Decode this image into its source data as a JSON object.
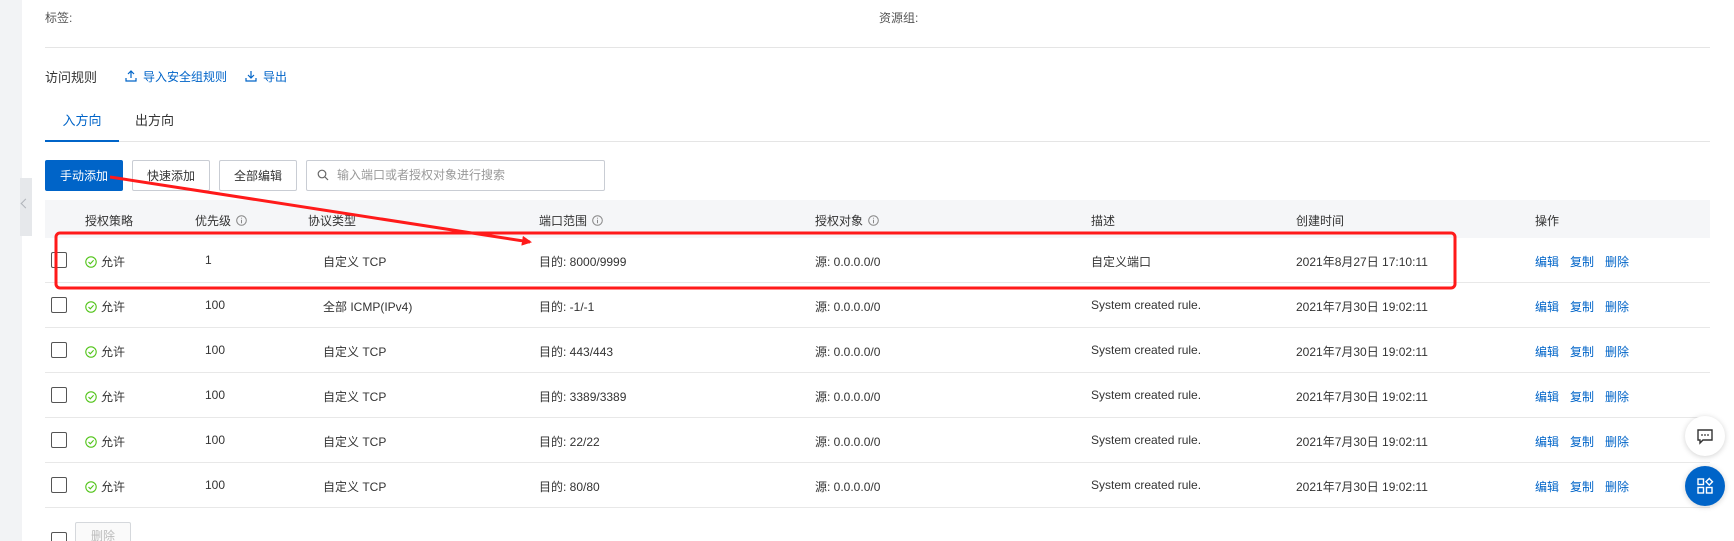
{
  "meta": {
    "tag_label": "标签:",
    "resource_group_label": "资源组:"
  },
  "rules": {
    "title": "访问规则",
    "import_label": "导入安全组规则",
    "export_label": "导出"
  },
  "tabs": {
    "inbound": "入方向",
    "outbound": "出方向"
  },
  "toolbar": {
    "manual_add": "手动添加",
    "quick_add": "快速添加",
    "edit_all": "全部编辑",
    "search_placeholder": "输入端口或者授权对象进行搜索"
  },
  "table": {
    "headers": {
      "policy": "授权策略",
      "priority": "优先级",
      "protocol": "协议类型",
      "port_range": "端口范围",
      "auth_object": "授权对象",
      "description": "描述",
      "created": "创建时间",
      "actions": "操作"
    },
    "actions": {
      "edit": "编辑",
      "copy": "复制",
      "delete": "删除"
    },
    "rows": [
      {
        "policy": "允许",
        "priority": "1",
        "protocol": "自定义 TCP",
        "port": "目的: 8000/9999",
        "source": "源: 0.0.0.0/0",
        "desc": "自定义端口",
        "created": "2021年8月27日 17:10:11"
      },
      {
        "policy": "允许",
        "priority": "100",
        "protocol": "全部 ICMP(IPv4)",
        "port": "目的: -1/-1",
        "source": "源: 0.0.0.0/0",
        "desc": "System created rule.",
        "created": "2021年7月30日 19:02:11"
      },
      {
        "policy": "允许",
        "priority": "100",
        "protocol": "自定义 TCP",
        "port": "目的: 443/443",
        "source": "源: 0.0.0.0/0",
        "desc": "System created rule.",
        "created": "2021年7月30日 19:02:11"
      },
      {
        "policy": "允许",
        "priority": "100",
        "protocol": "自定义 TCP",
        "port": "目的: 3389/3389",
        "source": "源: 0.0.0.0/0",
        "desc": "System created rule.",
        "created": "2021年7月30日 19:02:11"
      },
      {
        "policy": "允许",
        "priority": "100",
        "protocol": "自定义 TCP",
        "port": "目的: 22/22",
        "source": "源: 0.0.0.0/0",
        "desc": "System created rule.",
        "created": "2021年7月30日 19:02:11"
      },
      {
        "policy": "允许",
        "priority": "100",
        "protocol": "自定义 TCP",
        "port": "目的: 80/80",
        "source": "源: 0.0.0.0/0",
        "desc": "System created rule.",
        "created": "2021年7月30日 19:02:11"
      }
    ]
  },
  "bottom": {
    "delete_label": "删除"
  },
  "colors": {
    "accent": "#0064c8",
    "allow_green": "#52c41a",
    "annotation_red": "#ff1a1a"
  },
  "icons": {
    "import": "upload-icon",
    "export": "download-icon",
    "search": "search-icon",
    "info": "info-circle-icon",
    "allow": "check-circle-icon",
    "chat": "chat-icon",
    "apps": "apps-icon"
  }
}
